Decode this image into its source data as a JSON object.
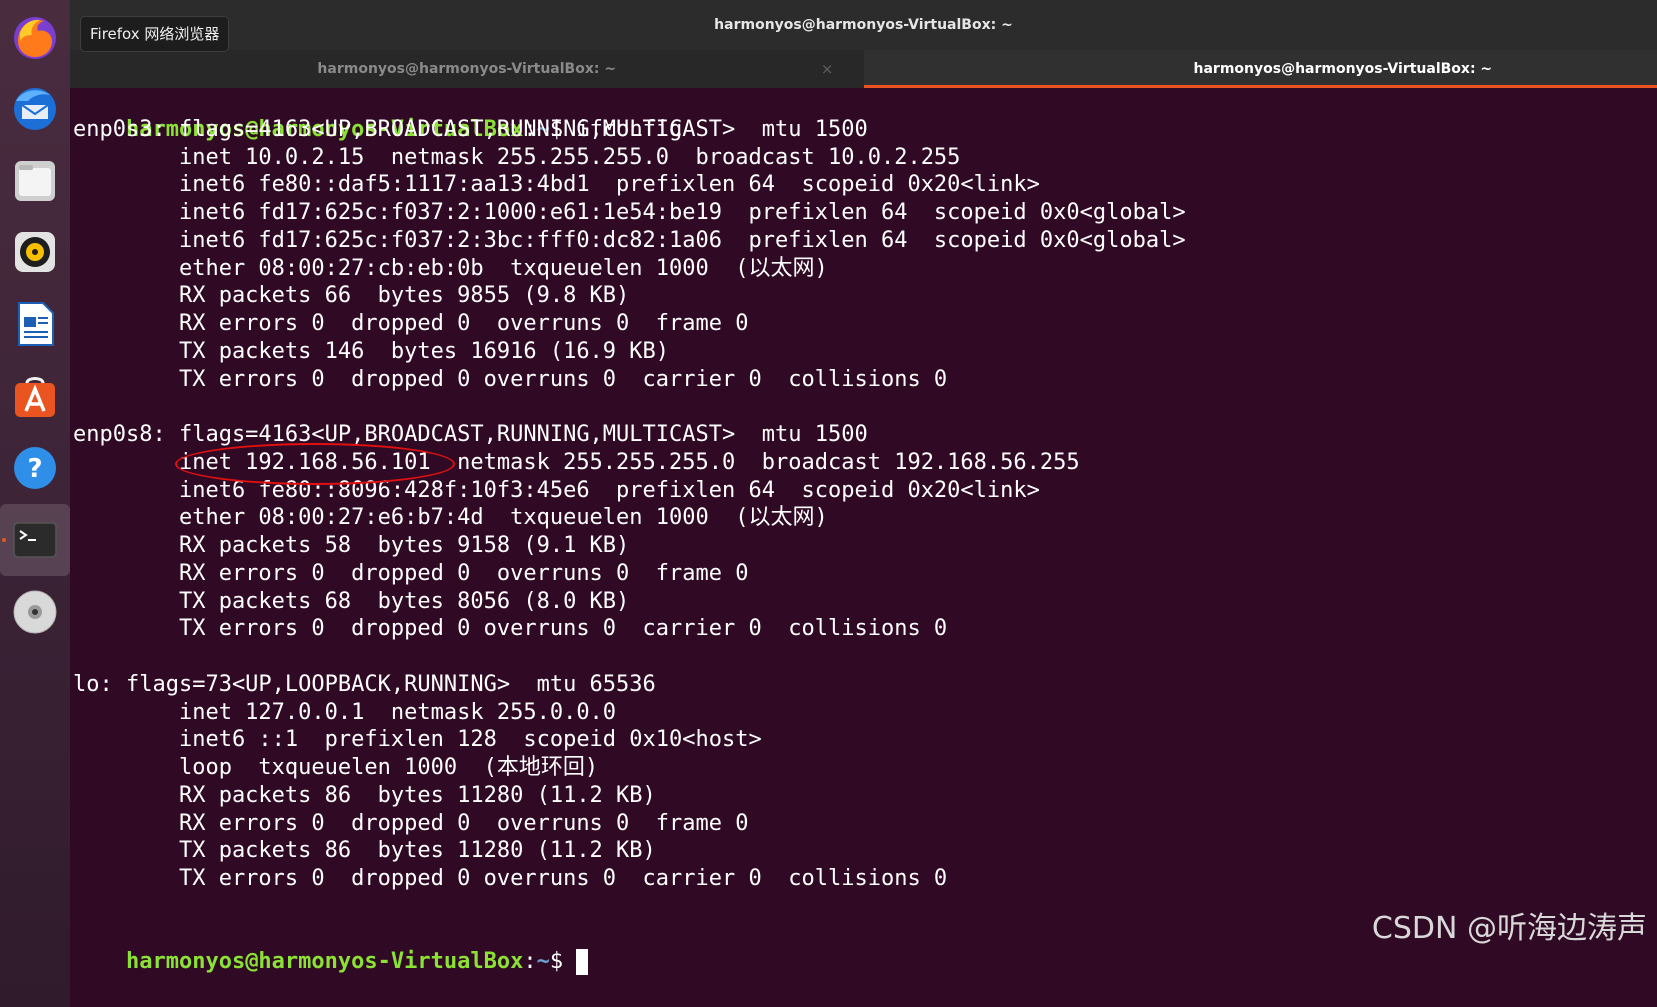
{
  "dock": {
    "items": [
      {
        "name": "firefox-icon"
      },
      {
        "name": "thunderbird-icon"
      },
      {
        "name": "files-icon"
      },
      {
        "name": "rhythmbox-icon"
      },
      {
        "name": "writer-icon"
      },
      {
        "name": "software-icon"
      },
      {
        "name": "help-icon"
      },
      {
        "name": "terminal-icon",
        "active": true
      },
      {
        "name": "disc-icon"
      }
    ]
  },
  "tooltip": "Firefox 网络浏览器",
  "window": {
    "title": "harmonyos@harmonyos-VirtualBox: ~"
  },
  "tabs": [
    {
      "label": "harmonyos@harmonyos-VirtualBox: ~",
      "close": "×",
      "active": false
    },
    {
      "label": "harmonyos@harmonyos-VirtualBox: ~",
      "active": true
    }
  ],
  "terminal": {
    "prompt_user": "harmonyos@harmonyos-VirtualBox",
    "prompt_path": "~",
    "prompt_sep": ":",
    "prompt_symbol": "$",
    "command": " ifconfig",
    "output": [
      "enp0s3: flags=4163<UP,BROADCAST,RUNNING,MULTICAST>  mtu 1500",
      "        inet 10.0.2.15  netmask 255.255.255.0  broadcast 10.0.2.255",
      "        inet6 fe80::daf5:1117:aa13:4bd1  prefixlen 64  scopeid 0x20<link>",
      "        inet6 fd17:625c:f037:2:1000:e61:1e54:be19  prefixlen 64  scopeid 0x0<global>",
      "        inet6 fd17:625c:f037:2:3bc:fff0:dc82:1a06  prefixlen 64  scopeid 0x0<global>",
      "        ether 08:00:27:cb:eb:0b  txqueuelen 1000  (以太网)",
      "        RX packets 66  bytes 9855 (9.8 KB)",
      "        RX errors 0  dropped 0  overruns 0  frame 0",
      "        TX packets 146  bytes 16916 (16.9 KB)",
      "        TX errors 0  dropped 0 overruns 0  carrier 0  collisions 0",
      "",
      "enp0s8: flags=4163<UP,BROADCAST,RUNNING,MULTICAST>  mtu 1500",
      "        inet 192.168.56.101  netmask 255.255.255.0  broadcast 192.168.56.255",
      "        inet6 fe80::8096:428f:10f3:45e6  prefixlen 64  scopeid 0x20<link>",
      "        ether 08:00:27:e6:b7:4d  txqueuelen 1000  (以太网)",
      "        RX packets 58  bytes 9158 (9.1 KB)",
      "        RX errors 0  dropped 0  overruns 0  frame 0",
      "        TX packets 68  bytes 8056 (8.0 KB)",
      "        TX errors 0  dropped 0 overruns 0  carrier 0  collisions 0",
      "",
      "lo: flags=73<UP,LOOPBACK,RUNNING>  mtu 65536",
      "        inet 127.0.0.1  netmask 255.0.0.0",
      "        inet6 ::1  prefixlen 128  scopeid 0x10<host>",
      "        loop  txqueuelen 1000  (本地环回)",
      "        RX packets 86  bytes 11280 (11.2 KB)",
      "        RX errors 0  dropped 0  overruns 0  frame 0",
      "        TX packets 86  bytes 11280 (11.2 KB)",
      "        TX errors 0  dropped 0 overruns 0  carrier 0  collisions 0",
      ""
    ]
  },
  "watermark": "CSDN @听海边涛声",
  "colors": {
    "terminal_bg": "#300a24",
    "prompt_user": "#8ae234",
    "prompt_path": "#729fcf",
    "accent": "#e95420",
    "highlight": "#e11010"
  }
}
